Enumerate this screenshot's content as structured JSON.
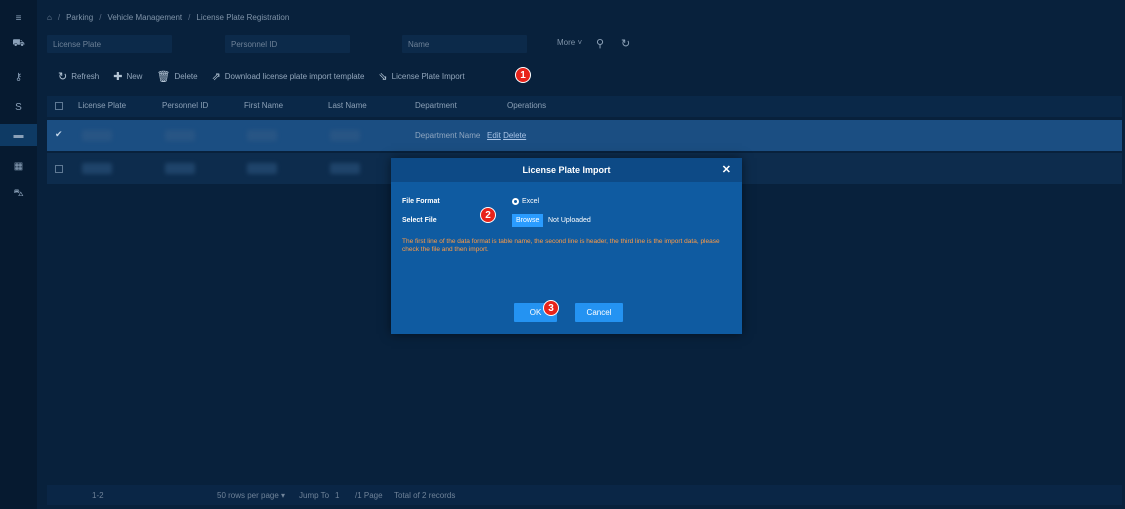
{
  "breadcrumb": {
    "items": [
      "Parking",
      "Vehicle Management",
      "License Plate Registration"
    ],
    "separator": "/"
  },
  "filters": {
    "license_plate": "License Plate",
    "personnel_id": "Personnel ID",
    "name": "Name",
    "more": "More ˅"
  },
  "toolbar": {
    "refresh": "Refresh",
    "new": "New",
    "delete": "Delete",
    "download_template": "Download license plate import template",
    "import": "License Plate Import"
  },
  "table": {
    "columns": [
      "License Plate",
      "Personnel ID",
      "First Name",
      "Last Name",
      "Department",
      "Operations"
    ],
    "rows": [
      {
        "department": "Department Name",
        "edit": "Edit",
        "delete": "Delete"
      }
    ]
  },
  "pagination": {
    "range": "1-2",
    "per_page": "50 rows per page",
    "jump_label": "Jump To",
    "jump_value": "1",
    "pages": "/1 Page",
    "total": "Total of 2 records"
  },
  "modal": {
    "title": "License Plate Import",
    "file_format_label": "File Format",
    "file_format_value": "Excel",
    "select_file_label": "Select File",
    "browse": "Browse",
    "upload_status": "Not Uploaded",
    "warning": "The first line of the data format is table name, the second line is header, the third line is the import data, please check the file and then import.",
    "ok": "OK",
    "cancel": "Cancel"
  },
  "badges": [
    "1",
    "2",
    "3"
  ],
  "colors": {
    "background": "#08213c",
    "selected_row": "#1b4e82",
    "modal": "#0f5ba1",
    "warning_text": "#ff9b45",
    "badge": "#e8231a",
    "primary_button": "#2493f2"
  }
}
